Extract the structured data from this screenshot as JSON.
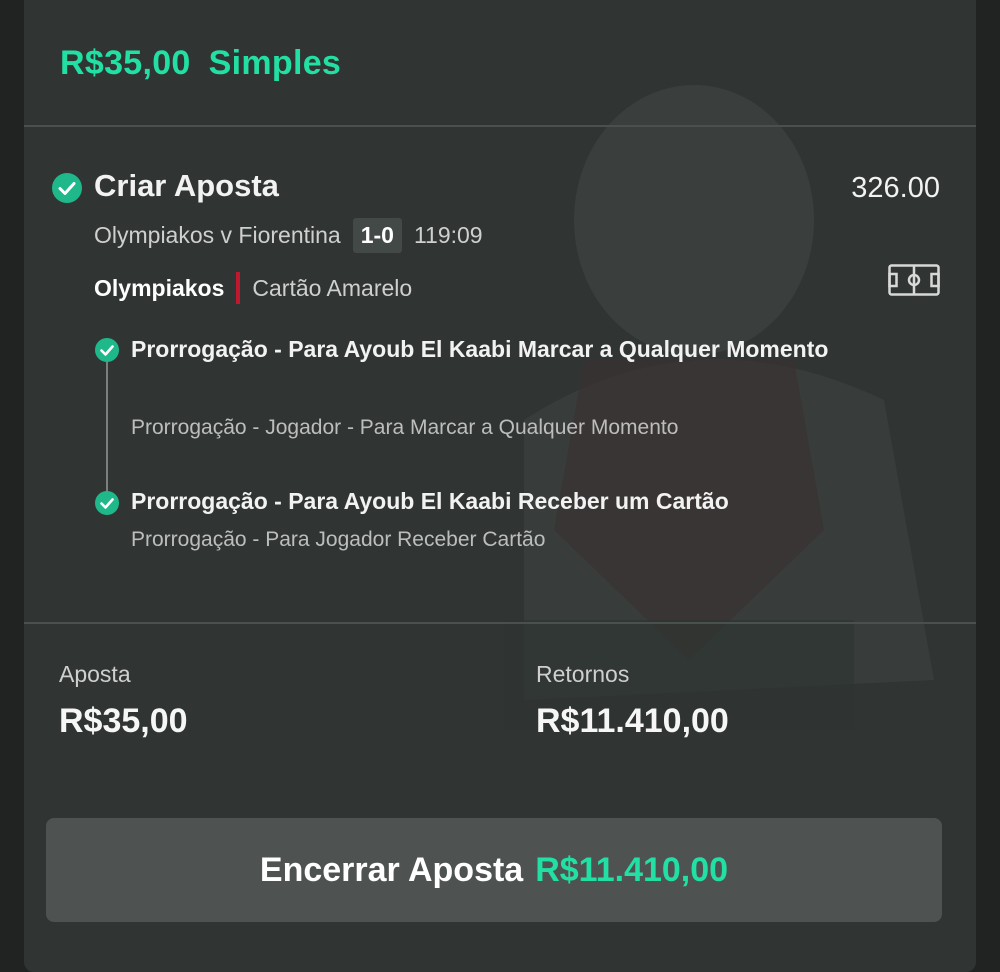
{
  "header": {
    "stake": "R$35,00",
    "bet_type": "Simples"
  },
  "selection": {
    "title": "Criar Aposta",
    "odds": "326.00",
    "match": "Olympiakos v Fiorentina",
    "score": "1-0",
    "clock": "119:09",
    "team": "Olympiakos",
    "market": "Cartão Amarelo",
    "legs": [
      {
        "title": "Prorrogação - Para Ayoub El Kaabi Marcar a Qualquer Momento",
        "subtitle": "Prorrogação - Jogador - Para Marcar a Qualquer Momento"
      },
      {
        "title": "Prorrogação - Para Ayoub El Kaabi Receber um Cartão",
        "subtitle": "Prorrogação - Para Jogador Receber Cartão"
      }
    ]
  },
  "summary": {
    "stake_label": "Aposta",
    "stake_value": "R$35,00",
    "returns_label": "Retornos",
    "returns_value": "R$11.410,00"
  },
  "cashout": {
    "label": "Encerrar Aposta",
    "amount": "R$11.410,00"
  },
  "icons": {
    "selection_status": "check-circle-icon",
    "stats": "football-pitch-icon"
  },
  "colors": {
    "accent": "#22e0a4",
    "check": "#1fb88a",
    "card_indicator": "#c0182e"
  }
}
